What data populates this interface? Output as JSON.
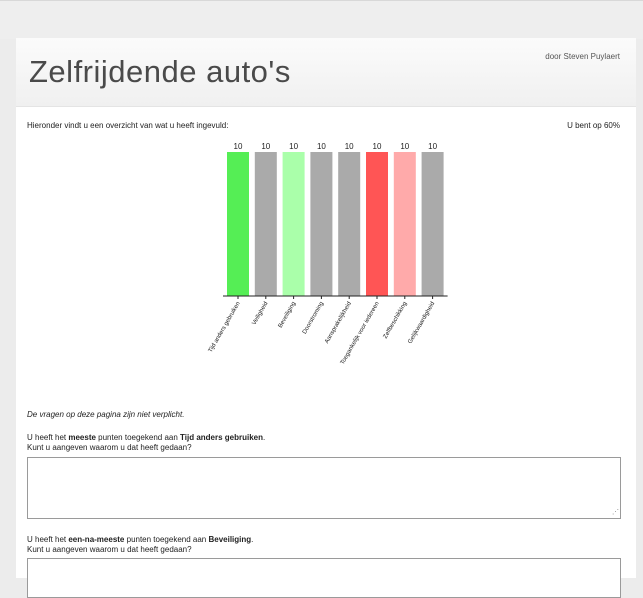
{
  "header": {
    "title": "Zelfrijdende auto's",
    "author": "door Steven Puylaert"
  },
  "overview_text": "Hieronder vindt u een overzicht van wat u heeft ingevuld:",
  "progress_text": "U bent op 60%",
  "chart_data": {
    "type": "bar",
    "categories": [
      "Tijd anders gebruiken",
      "Veiligheid",
      "Beveiliging",
      "Doorstroming",
      "Aansprakelijkheid",
      "Toegankelijk voor iedereen",
      "Zelfbeschikking",
      "Gelijkwaardigheid"
    ],
    "values": [
      10,
      10,
      10,
      10,
      10,
      10,
      10,
      10
    ],
    "colors": [
      "#55ee55",
      "#aaaaaa",
      "#aaffaa",
      "#aaaaaa",
      "#aaaaaa",
      "#ff5555",
      "#ffaaaa",
      "#aaaaaa"
    ],
    "ylim": [
      0,
      10
    ],
    "grid": false
  },
  "optional_note": "De vragen op deze pagina zijn niet verplicht.",
  "questions": [
    {
      "p1": "U heeft het ",
      "rank": "meeste",
      "p2": " punten toegekend aan ",
      "item": "Tijd anders gebruiken",
      "p3": ".",
      "line2": "Kunt u aangeven waarom u dat heeft gedaan?",
      "answer": ""
    },
    {
      "p1": "U heeft het ",
      "rank": "een-na-meeste",
      "p2": " punten toegekend aan ",
      "item": "Beveiliging",
      "p3": ".",
      "line2": "Kunt u aangeven waarom u dat heeft gedaan?",
      "answer": ""
    }
  ]
}
